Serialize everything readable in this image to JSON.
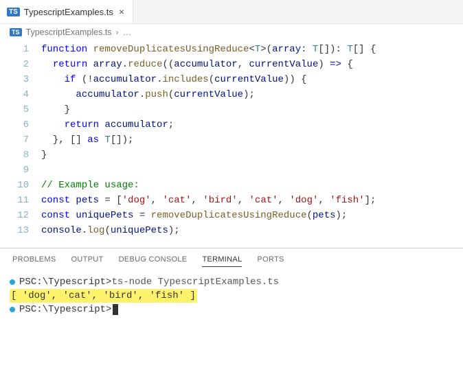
{
  "tab": {
    "icon_label": "TS",
    "filename": "TypescriptExamples.ts",
    "close_glyph": "×"
  },
  "breadcrumb": {
    "icon_label": "TS",
    "filename": "TypescriptExamples.ts",
    "chev": "›",
    "dots": "…"
  },
  "code": {
    "lines": [
      {
        "n": "1",
        "tokens": [
          [
            "kw",
            "function"
          ],
          [
            "punc",
            " "
          ],
          [
            "fn",
            "removeDuplicatesUsingReduce"
          ],
          [
            "punc",
            "<"
          ],
          [
            "type",
            "T"
          ],
          [
            "punc",
            ">("
          ],
          [
            "var",
            "array"
          ],
          [
            "punc",
            ": "
          ],
          [
            "type",
            "T"
          ],
          [
            "punc",
            "[]): "
          ],
          [
            "type",
            "T"
          ],
          [
            "punc",
            "[] {"
          ]
        ]
      },
      {
        "n": "2",
        "tokens": [
          [
            "punc",
            "  "
          ],
          [
            "kw",
            "return"
          ],
          [
            "punc",
            " "
          ],
          [
            "var",
            "array"
          ],
          [
            "punc",
            "."
          ],
          [
            "fn",
            "reduce"
          ],
          [
            "punc",
            "(("
          ],
          [
            "var",
            "accumulator"
          ],
          [
            "punc",
            ", "
          ],
          [
            "var",
            "currentValue"
          ],
          [
            "punc",
            ") "
          ],
          [
            "kw",
            "=>"
          ],
          [
            "punc",
            " {"
          ]
        ]
      },
      {
        "n": "3",
        "tokens": [
          [
            "punc",
            "    "
          ],
          [
            "kw",
            "if"
          ],
          [
            "punc",
            " (!"
          ],
          [
            "var",
            "accumulator"
          ],
          [
            "punc",
            "."
          ],
          [
            "fn",
            "includes"
          ],
          [
            "punc",
            "("
          ],
          [
            "var",
            "currentValue"
          ],
          [
            "punc",
            ")) {"
          ]
        ]
      },
      {
        "n": "4",
        "tokens": [
          [
            "punc",
            "      "
          ],
          [
            "var",
            "accumulator"
          ],
          [
            "punc",
            "."
          ],
          [
            "fn",
            "push"
          ],
          [
            "punc",
            "("
          ],
          [
            "var",
            "currentValue"
          ],
          [
            "punc",
            ");"
          ]
        ]
      },
      {
        "n": "5",
        "tokens": [
          [
            "punc",
            "    }"
          ]
        ]
      },
      {
        "n": "6",
        "tokens": [
          [
            "punc",
            "    "
          ],
          [
            "kw",
            "return"
          ],
          [
            "punc",
            " "
          ],
          [
            "var",
            "accumulator"
          ],
          [
            "punc",
            ";"
          ]
        ]
      },
      {
        "n": "7",
        "tokens": [
          [
            "punc",
            "  }, [] "
          ],
          [
            "kw",
            "as"
          ],
          [
            "punc",
            " "
          ],
          [
            "type",
            "T"
          ],
          [
            "punc",
            "[]);"
          ]
        ]
      },
      {
        "n": "8",
        "tokens": [
          [
            "punc",
            "}"
          ]
        ]
      },
      {
        "n": "9",
        "tokens": [
          [
            "punc",
            ""
          ]
        ]
      },
      {
        "n": "10",
        "tokens": [
          [
            "com",
            "// Example usage:"
          ]
        ]
      },
      {
        "n": "11",
        "tokens": [
          [
            "kw",
            "const"
          ],
          [
            "punc",
            " "
          ],
          [
            "var",
            "pets"
          ],
          [
            "punc",
            " = ["
          ],
          [
            "str",
            "'dog'"
          ],
          [
            "punc",
            ", "
          ],
          [
            "str",
            "'cat'"
          ],
          [
            "punc",
            ", "
          ],
          [
            "str",
            "'bird'"
          ],
          [
            "punc",
            ", "
          ],
          [
            "str",
            "'cat'"
          ],
          [
            "punc",
            ", "
          ],
          [
            "str",
            "'dog'"
          ],
          [
            "punc",
            ", "
          ],
          [
            "str",
            "'fish'"
          ],
          [
            "punc",
            "];"
          ]
        ]
      },
      {
        "n": "12",
        "tokens": [
          [
            "kw",
            "const"
          ],
          [
            "punc",
            " "
          ],
          [
            "var",
            "uniquePets"
          ],
          [
            "punc",
            " = "
          ],
          [
            "fn",
            "removeDuplicatesUsingReduce"
          ],
          [
            "punc",
            "("
          ],
          [
            "var",
            "pets"
          ],
          [
            "punc",
            ");"
          ]
        ]
      },
      {
        "n": "13",
        "tokens": [
          [
            "obj",
            "console"
          ],
          [
            "punc",
            "."
          ],
          [
            "fn",
            "log"
          ],
          [
            "punc",
            "("
          ],
          [
            "var",
            "uniquePets"
          ],
          [
            "punc",
            ");"
          ]
        ]
      }
    ]
  },
  "panel": {
    "tabs": {
      "problems": "PROBLEMS",
      "output": "OUTPUT",
      "debug": "DEBUG CONSOLE",
      "terminal": "TERMINAL",
      "ports": "PORTS"
    }
  },
  "terminal": {
    "line1": {
      "ps": "PS ",
      "path": "C:\\Typescript> ",
      "cmd": "ts-node TypescriptExamples.ts"
    },
    "line2": {
      "output": "[ 'dog', 'cat', 'bird', 'fish' ]"
    },
    "line3": {
      "ps": "PS ",
      "path": "C:\\Typescript> "
    }
  }
}
